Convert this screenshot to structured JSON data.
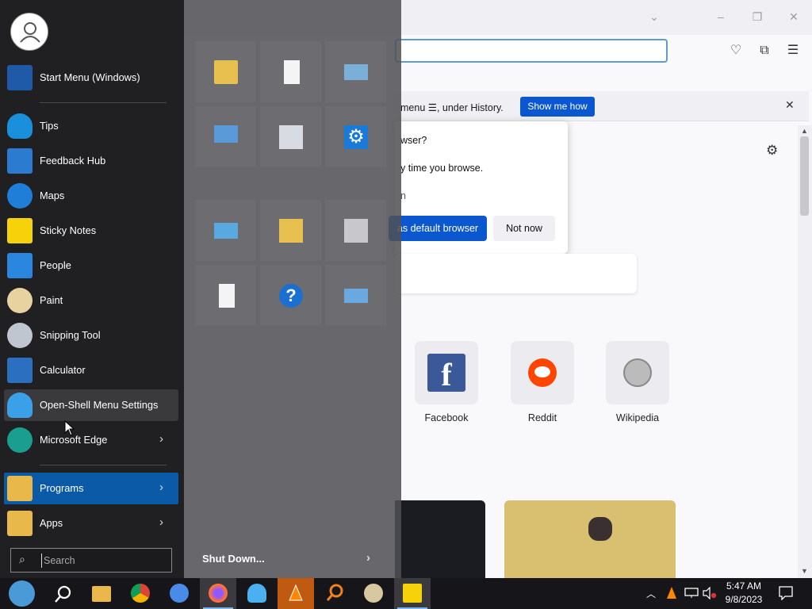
{
  "browser": {
    "notice_text": "menu ☰, under History.",
    "notice_button": "Show me how",
    "dialog_line1": "wser?",
    "dialog_line2": "y time you browse.",
    "dialog_line3": "n",
    "dialog_default_button": "as default browser",
    "dialog_not_now_button": "Not now",
    "shortcuts": [
      {
        "label": "Facebook"
      },
      {
        "label": "Reddit"
      },
      {
        "label": "Wikipedia"
      }
    ]
  },
  "start_menu": {
    "items": [
      {
        "label": "Start Menu (Windows)",
        "icon": "start-menu-icon"
      },
      {
        "label": "Tips",
        "icon": "lightbulb-icon"
      },
      {
        "label": "Feedback Hub",
        "icon": "feedback-hub-icon"
      },
      {
        "label": "Maps",
        "icon": "map-pin-icon"
      },
      {
        "label": "Sticky Notes",
        "icon": "sticky-note-icon"
      },
      {
        "label": "People",
        "icon": "people-icon"
      },
      {
        "label": "Paint",
        "icon": "palette-icon"
      },
      {
        "label": "Snipping Tool",
        "icon": "scissors-icon"
      },
      {
        "label": "Calculator",
        "icon": "calculator-icon"
      },
      {
        "label": "Open-Shell Menu Settings",
        "icon": "shell-icon"
      },
      {
        "label": "Microsoft Edge",
        "icon": "edge-icon"
      }
    ],
    "programs_label": "Programs",
    "apps_label": "Apps",
    "search_placeholder": "Search",
    "shutdown_label": "Shut Down...",
    "tiles": [
      {
        "name": "user-folder-icon"
      },
      {
        "name": "document-icon"
      },
      {
        "name": "picture-icon"
      },
      {
        "name": "computer-icon"
      },
      {
        "name": "control-panel-icon"
      },
      {
        "name": "settings-gear-icon"
      },
      {
        "name": "system-info-icon"
      },
      {
        "name": "network-folder-icon"
      },
      {
        "name": "printer-icon"
      },
      {
        "name": "search-document-icon"
      },
      {
        "name": "help-icon"
      },
      {
        "name": "run-icon"
      }
    ]
  },
  "taskbar": {
    "time": "5:47 AM",
    "date": "9/8/2023",
    "pinned": [
      {
        "name": "start-orb-icon"
      },
      {
        "name": "search-icon"
      },
      {
        "name": "file-explorer-icon"
      },
      {
        "name": "chrome-icon"
      },
      {
        "name": "chrome-alt-icon"
      },
      {
        "name": "firefox-icon"
      },
      {
        "name": "open-shell-icon"
      },
      {
        "name": "vlc-icon"
      },
      {
        "name": "magnifier-icon"
      },
      {
        "name": "paint-icon"
      },
      {
        "name": "sticky-notes-icon"
      }
    ]
  },
  "colors": {
    "accent_blue": "#0b5aa8",
    "button_blue": "#0b57d0",
    "menu_bg": "#202023"
  }
}
